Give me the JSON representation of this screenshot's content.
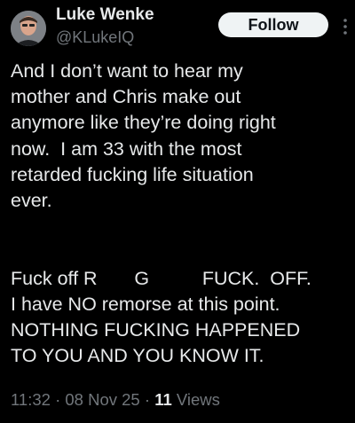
{
  "author": {
    "display_name": "Luke Wenke",
    "handle": "@KLukeIQ",
    "avatar_icon": "user-avatar-photo"
  },
  "follow_button": {
    "label": "Follow"
  },
  "more_menu": {
    "icon": "more-vertical-icon"
  },
  "tweet": {
    "lines": [
      "And I don’t want to hear my",
      "mother and Chris make out",
      "anymore like they’re doing right",
      "now.  I am 33 with the most",
      "retarded fucking life situation",
      "ever.",
      "",
      "",
      "Fuck off R       G          FUCK.  OFF.",
      "I have NO remorse at this point.",
      "NOTHING FUCKING HAPPENED",
      "TO YOU AND YOU KNOW IT."
    ]
  },
  "meta": {
    "time": "11:32",
    "separator": " · ",
    "date": "08 Nov 25",
    "views_count": "11",
    "views_label": " Views"
  },
  "colors": {
    "background": "#000000",
    "text": "#e7e9ea",
    "secondary": "#71767b",
    "button_bg": "#eff3f4"
  }
}
